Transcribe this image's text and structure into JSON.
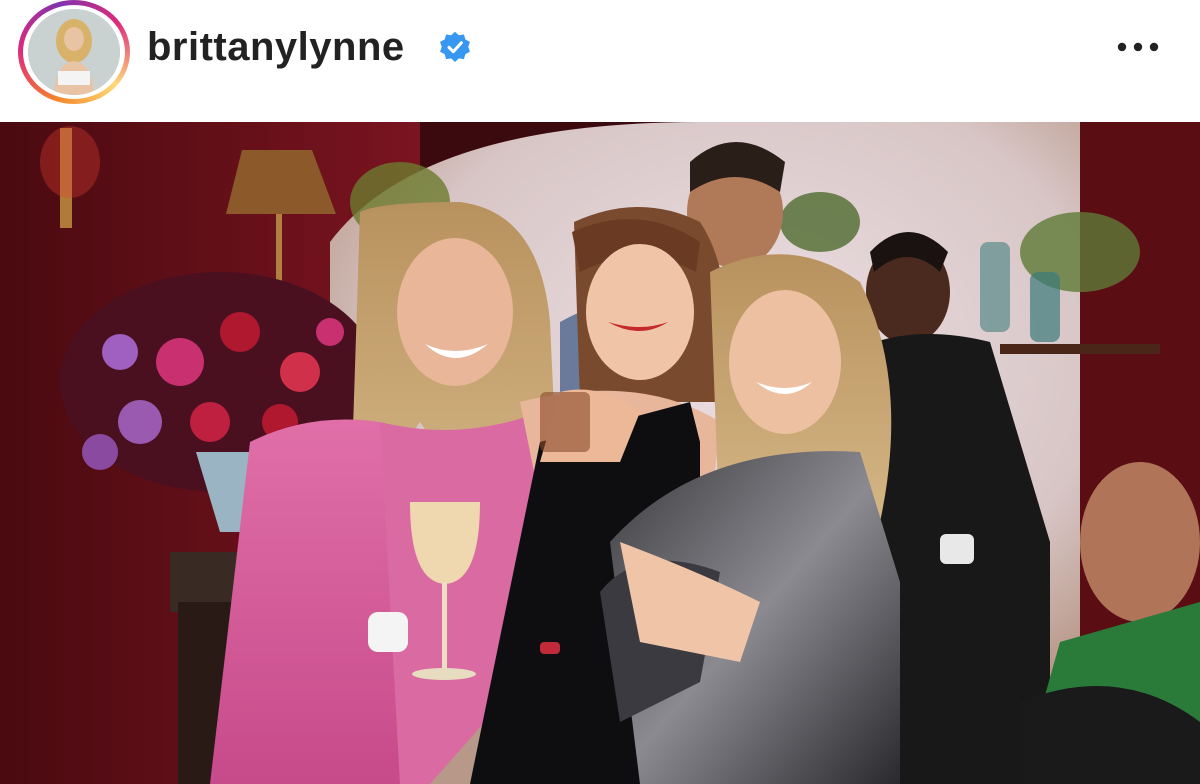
{
  "post": {
    "username": "brittanylynne",
    "verified": true,
    "avatar_icon": "profile-avatar",
    "more_icon": "more-horizontal-icon",
    "image_description": "photo"
  },
  "colors": {
    "verified_badge": "#3897f0",
    "text": "#222222",
    "ring_start": "#f58529",
    "ring_end": "#dd2a7b"
  }
}
